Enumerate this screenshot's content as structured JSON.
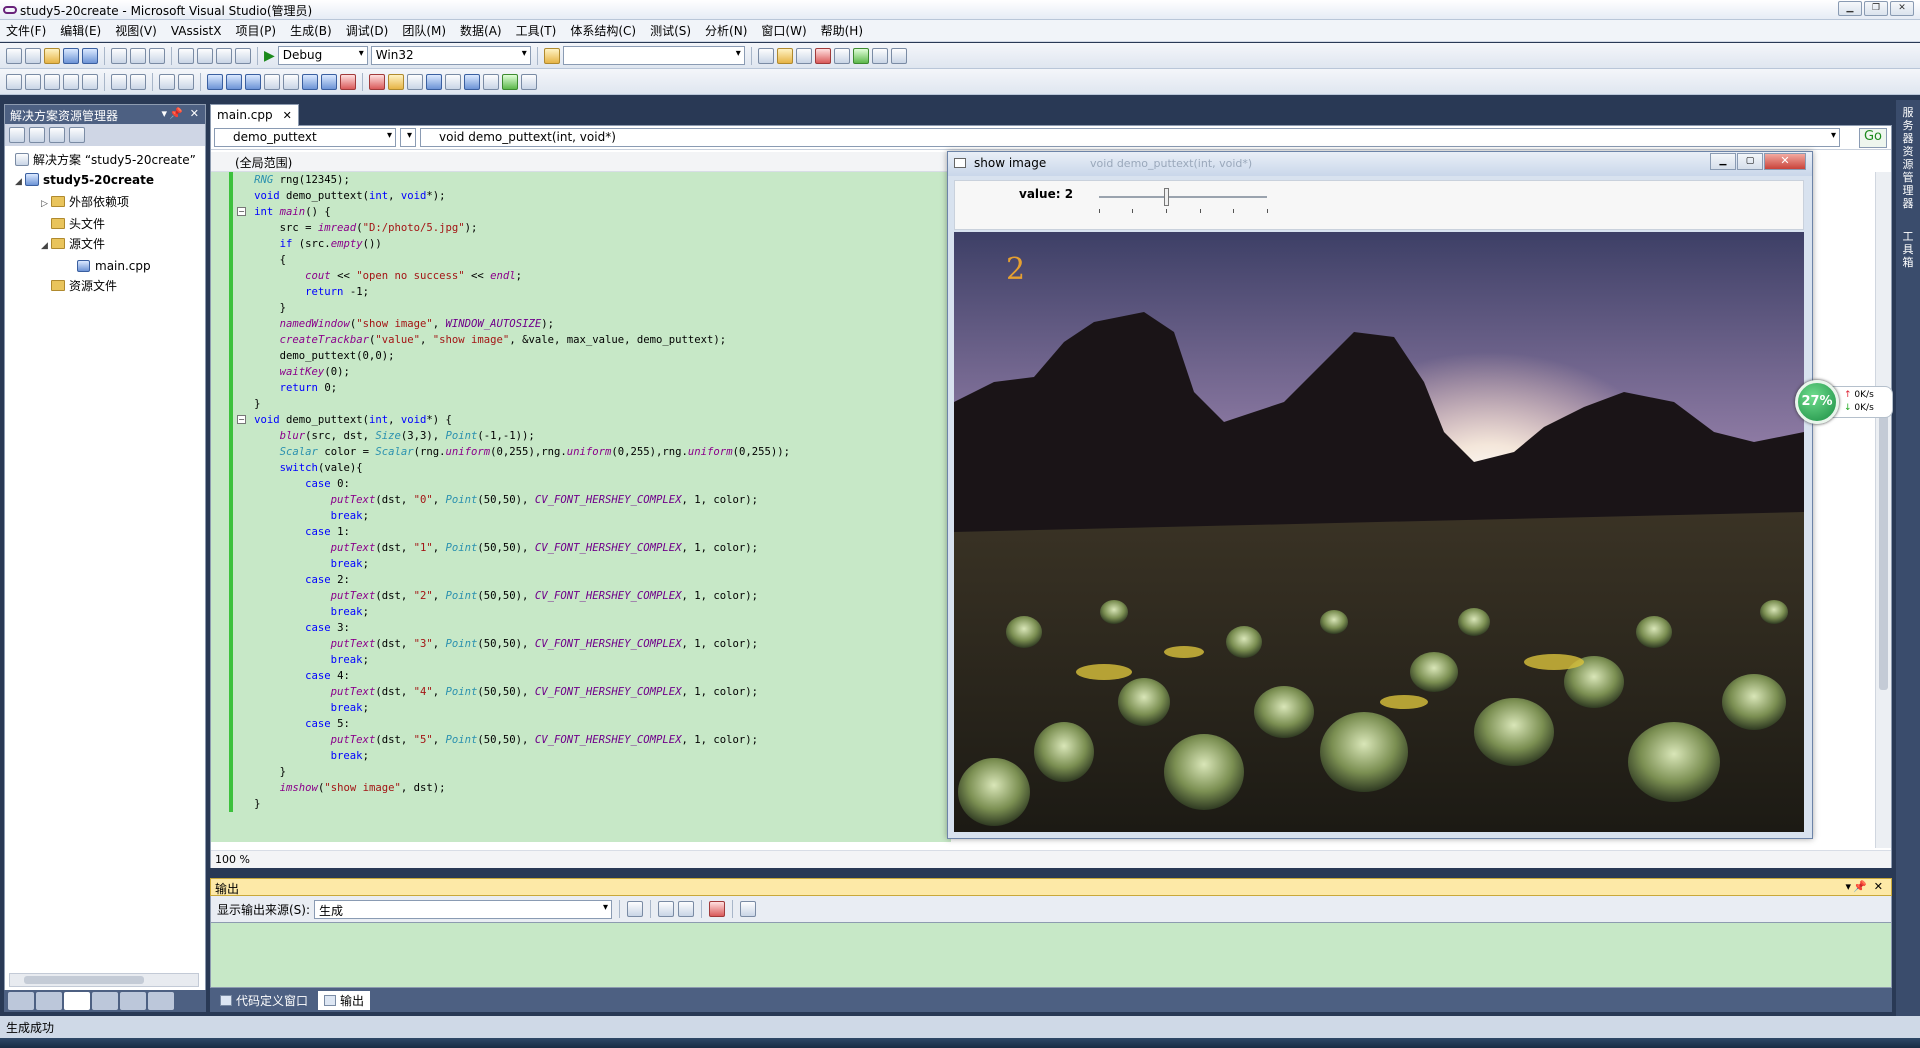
{
  "window": {
    "title": "study5-20create - Microsoft Visual Studio(管理员)"
  },
  "menu": [
    "文件(F)",
    "编辑(E)",
    "视图(V)",
    "VAssistX",
    "项目(P)",
    "生成(B)",
    "调试(D)",
    "团队(M)",
    "数据(A)",
    "工具(T)",
    "体系结构(C)",
    "测试(S)",
    "分析(N)",
    "窗口(W)",
    "帮助(H)"
  ],
  "toolbar": {
    "config": "Debug",
    "platform": "Win32",
    "find_value": ""
  },
  "solution_explorer": {
    "title": "解决方案资源管理器",
    "solution": "解决方案 “study5-20create”",
    "project": "study5-20create",
    "items": {
      "external": "外部依赖项",
      "headers": "头文件",
      "sources": "源文件",
      "main": "main.cpp",
      "resources": "资源文件"
    }
  },
  "editor": {
    "tab": "main.cpp",
    "nav_class": "demo_puttext",
    "nav_member": "void demo_puttext(int, void*)",
    "go": "Go",
    "scope": "(全局范围)",
    "zoom": "100 %"
  },
  "image_window": {
    "title": "show image",
    "ghost_title": "void demo_puttext(int, void*)",
    "trackbar_label": "value: 2",
    "trackbar_value": 2,
    "trackbar_max": 5,
    "overlay_text": "2"
  },
  "output": {
    "title": "输出",
    "source_label": "显示输出来源(S):",
    "source_value": "生成",
    "tab_code_def": "代码定义窗口",
    "tab_output": "输出"
  },
  "status": {
    "text": "生成成功"
  },
  "net_widget": {
    "percent": "27%",
    "up": "0K/s",
    "down": "0K/s"
  },
  "right_strip": {
    "item1": "服务器资源管理器",
    "item2": "工具箱"
  },
  "colors": {
    "code_bg": "#c7e8c7",
    "panel_header": "#4d6082",
    "output_header": "#fde9a7",
    "keyword": "#0000ff",
    "overlay": "#e6a030"
  }
}
